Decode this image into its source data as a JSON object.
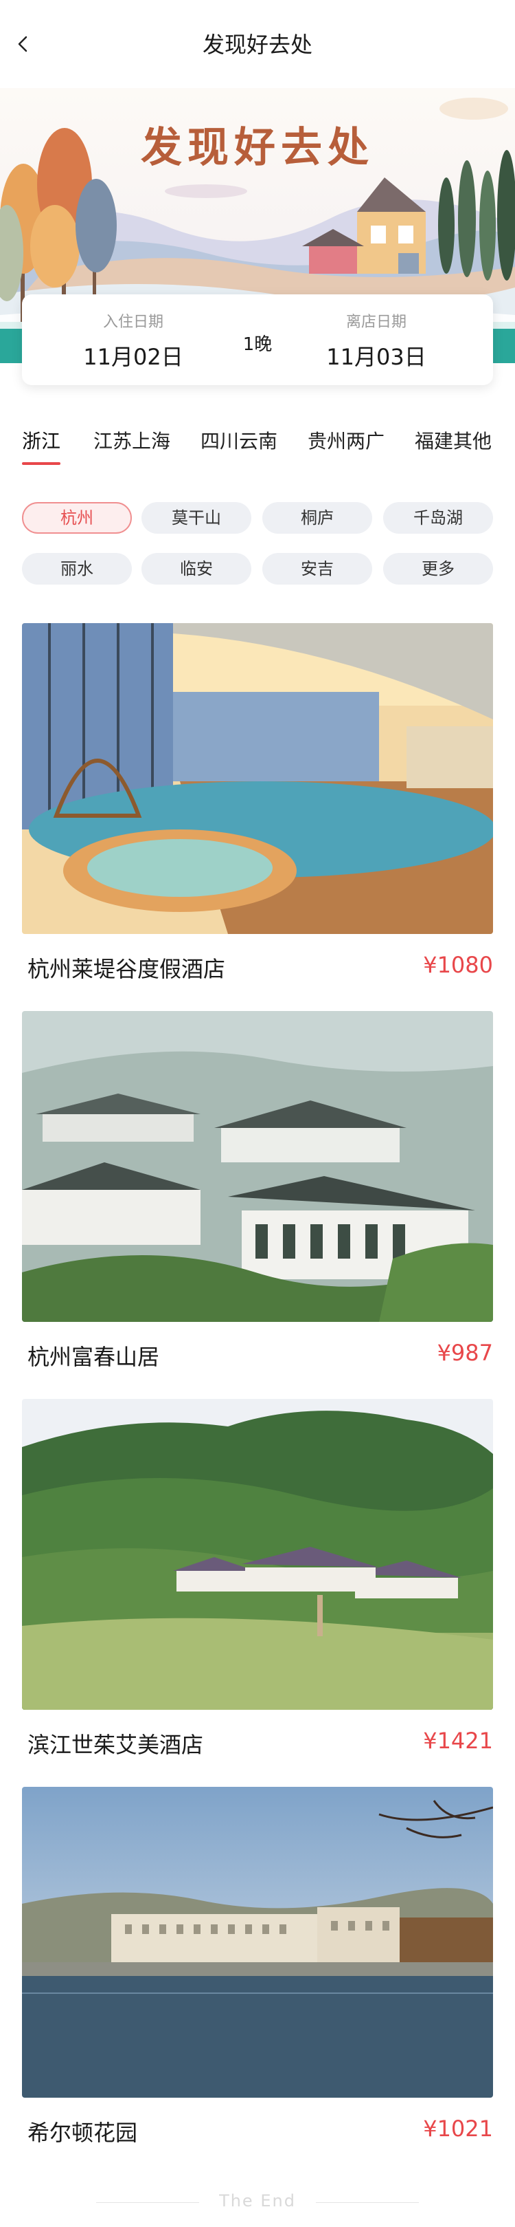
{
  "nav": {
    "title": "发现好去处"
  },
  "banner": {
    "title": "发现好去处"
  },
  "dates": {
    "checkin_label": "入住日期",
    "checkin_value": "11月02日",
    "nights": "1晚",
    "checkout_label": "离店日期",
    "checkout_value": "11月03日"
  },
  "tabs": [
    "浙江",
    "江苏上海",
    "四川云南",
    "贵州两广",
    "福建其他"
  ],
  "chips": [
    "杭州",
    "莫干山",
    "桐庐",
    "千岛湖",
    "丽水",
    "临安",
    "安吉",
    "更多"
  ],
  "hotels": [
    {
      "name": "杭州莱堤谷度假酒店",
      "price": "¥1080"
    },
    {
      "name": "杭州富春山居",
      "price": "¥987"
    },
    {
      "name": "滨江世茱艾美酒店",
      "price": "¥1421"
    },
    {
      "name": "希尔顿花园",
      "price": "¥1021"
    }
  ],
  "footer": {
    "text": "The  End"
  },
  "colors": {
    "accent": "#e8474a",
    "chip_bg": "#eef0f4"
  }
}
